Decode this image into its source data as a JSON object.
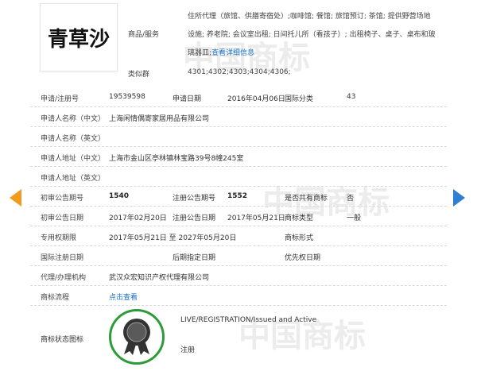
{
  "trademark": {
    "image_text": "青草沙"
  },
  "goods": {
    "label": "商品/服务",
    "text": "住所代理（旅馆、供膳寄宿处）;咖啡馆; 餐馆; 旅馆预订; 茶馆; 提供野营场地设施; 养老院; 会议室出租; 日间托儿所（看孩子）; 出租椅子、桌子、桌布和玻璃器皿;",
    "more_link": "查看详细信息"
  },
  "similar_group": {
    "label": "类似群",
    "value": "4301;4302;4303;4304;4306;"
  },
  "fields": {
    "reg_no_label": "申请/注册号",
    "reg_no": "19539598",
    "app_date_label": "申请日期",
    "app_date": "2016年04月06日",
    "intl_class_label": "国际分类",
    "intl_class": "43",
    "applicant_cn_label": "申请人名称（中文）",
    "applicant_cn": "上海闲情偶寄家居用品有限公司",
    "applicant_en_label": "申请人名称（英文）",
    "applicant_en": "",
    "address_cn_label": "申请人地址（中文）",
    "address_cn": "上海市金山区亭林镇林宝路39号8幢245室",
    "address_en_label": "申请人地址（英文）",
    "address_en": "",
    "prelim_issue_label": "初审公告期号",
    "prelim_issue": "1540",
    "reg_issue_label": "注册公告期号",
    "reg_issue": "1552",
    "shared_label": "是否共有商标",
    "shared": "否",
    "prelim_date_label": "初审公告日期",
    "prelim_date": "2017年02月20日",
    "reg_date_label": "注册公告日期",
    "reg_date": "2017年05月21日",
    "tm_type_label": "商标类型",
    "tm_type": "一般",
    "exclusive_label": "专用权期限",
    "exclusive": "2017年05月21日 至 2027年05月20日",
    "tm_form_label": "商标形式",
    "tm_form": "",
    "intl_reg_date_label": "国际注册日期",
    "intl_reg_date": "",
    "later_date_label": "后期指定日期",
    "later_date": "",
    "priority_date_label": "优先权日期",
    "priority_date": "",
    "agent_label": "代理/办理机构",
    "agent": "武汉众宏知识产权代理有限公司",
    "process_label": "商标流程",
    "process_link": "点击查看"
  },
  "status": {
    "label": "商标状态图标",
    "text": "LIVE/REGISTRATION/Issued and Active",
    "subtext": "注册",
    "seal_color": "#2e9b3a"
  },
  "watermark": {
    "text": "中国商标"
  },
  "nav": {
    "prev_icon": "arrow-left-icon",
    "next_icon": "arrow-right-icon",
    "prev_color": "#f39a1e",
    "next_color": "#2d7fd1"
  }
}
